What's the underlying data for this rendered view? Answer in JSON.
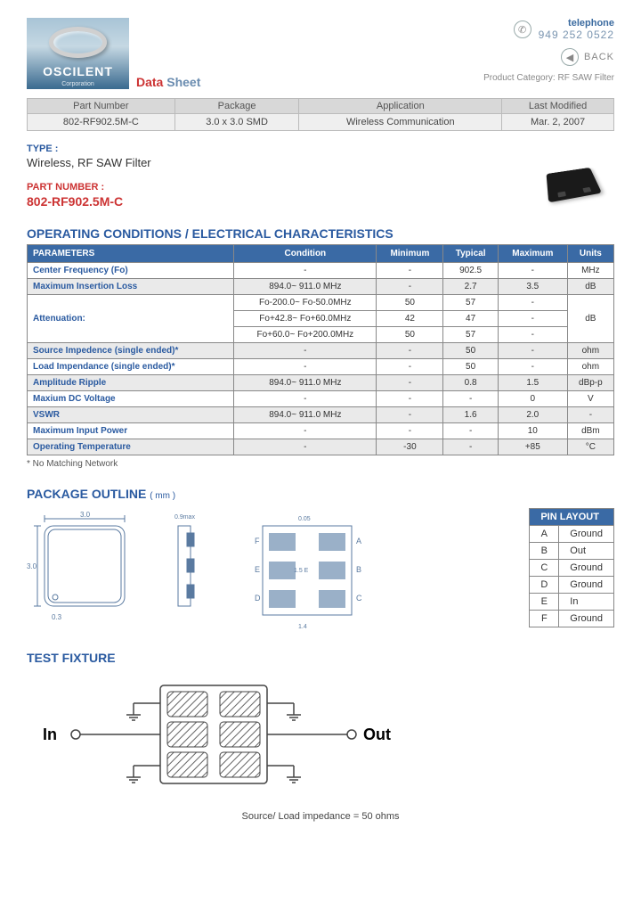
{
  "header": {
    "brand": "OSCILENT",
    "corp": "Corporation",
    "ds_red": "Data",
    "ds_blue": "Sheet",
    "tel_label": "telephone",
    "tel_num": "949 252 0522",
    "back": "BACK",
    "pcat": "Product Category: RF SAW Filter"
  },
  "info": {
    "headers": [
      "Part Number",
      "Package",
      "Application",
      "Last Modified"
    ],
    "values": [
      "802-RF902.5M-C",
      "3.0 x 3.0 SMD",
      "Wireless Communication",
      "Mar. 2, 2007"
    ]
  },
  "type": {
    "label": "TYPE :",
    "value": "Wireless, RF SAW Filter"
  },
  "partnum": {
    "label": "PART NUMBER :",
    "value": "802-RF902.5M-C"
  },
  "characteristics": {
    "title": "OPERATING CONDITIONS / ELECTRICAL CHARACTERISTICS",
    "headers": [
      "PARAMETERS",
      "Condition",
      "Minimum",
      "Typical",
      "Maximum",
      "Units"
    ],
    "rows": [
      {
        "param": "Center Frequency (Fo)",
        "cond": "-",
        "min": "-",
        "typ": "902.5",
        "max": "-",
        "units": "MHz",
        "shade": false
      },
      {
        "param": "Maximum Insertion Loss",
        "cond": "894.0~ 911.0 MHz",
        "min": "-",
        "typ": "2.7",
        "max": "3.5",
        "units": "dB",
        "shade": true
      },
      {
        "param": "Attenuation:",
        "rowspan": 3,
        "sub": [
          {
            "cond": "Fo-200.0~ Fo-50.0MHz",
            "min": "50",
            "typ": "57",
            "max": "-"
          },
          {
            "cond": "Fo+42.8~ Fo+60.0MHz",
            "min": "42",
            "typ": "47",
            "max": "-"
          },
          {
            "cond": "Fo+60.0~ Fo+200.0MHz",
            "min": "50",
            "typ": "57",
            "max": "-"
          }
        ],
        "units": "dB",
        "shade": false
      },
      {
        "param": "Source Impedence (single ended)*",
        "cond": "-",
        "min": "-",
        "typ": "50",
        "max": "-",
        "units": "ohm",
        "shade": true
      },
      {
        "param": "Load Impendance (single ended)*",
        "cond": "-",
        "min": "-",
        "typ": "50",
        "max": "-",
        "units": "ohm",
        "shade": false
      },
      {
        "param": "Amplitude Ripple",
        "cond": "894.0~ 911.0 MHz",
        "min": "-",
        "typ": "0.8",
        "max": "1.5",
        "units": "dBp-p",
        "shade": true
      },
      {
        "param": "Maxium DC Voltage",
        "cond": "-",
        "min": "-",
        "typ": "-",
        "max": "0",
        "units": "V",
        "shade": false
      },
      {
        "param": "VSWR",
        "cond": "894.0~ 911.0 MHz",
        "min": "-",
        "typ": "1.6",
        "max": "2.0",
        "units": "-",
        "shade": true
      },
      {
        "param": "Maximum Input Power",
        "cond": "-",
        "min": "-",
        "typ": "-",
        "max": "10",
        "units": "dBm",
        "shade": false
      },
      {
        "param": "Operating Temperature",
        "cond": "-",
        "min": "-30",
        "typ": "-",
        "max": "+85",
        "units": "°C",
        "shade": true
      }
    ],
    "note": "* No Matching Network"
  },
  "package": {
    "title": "PACKAGE OUTLINE",
    "title_sub": "( mm )",
    "dims": {
      "w": "3.0",
      "h": "3.0",
      "r": "0.3",
      "t": "0.9max",
      "pad_gap": "0.05",
      "pad_pitch": "1.5",
      "pad_e": "1.5 E",
      "pad_w": "1.4"
    },
    "pin_header": "PIN LAYOUT",
    "pins": [
      {
        "p": "A",
        "f": "Ground"
      },
      {
        "p": "B",
        "f": "Out"
      },
      {
        "p": "C",
        "f": "Ground"
      },
      {
        "p": "D",
        "f": "Ground"
      },
      {
        "p": "E",
        "f": "In"
      },
      {
        "p": "F",
        "f": "Ground"
      }
    ]
  },
  "fixture": {
    "title": "TEST FIXTURE",
    "in": "In",
    "out": "Out",
    "caption": "Source/ Load impedance = 50 ohms"
  }
}
